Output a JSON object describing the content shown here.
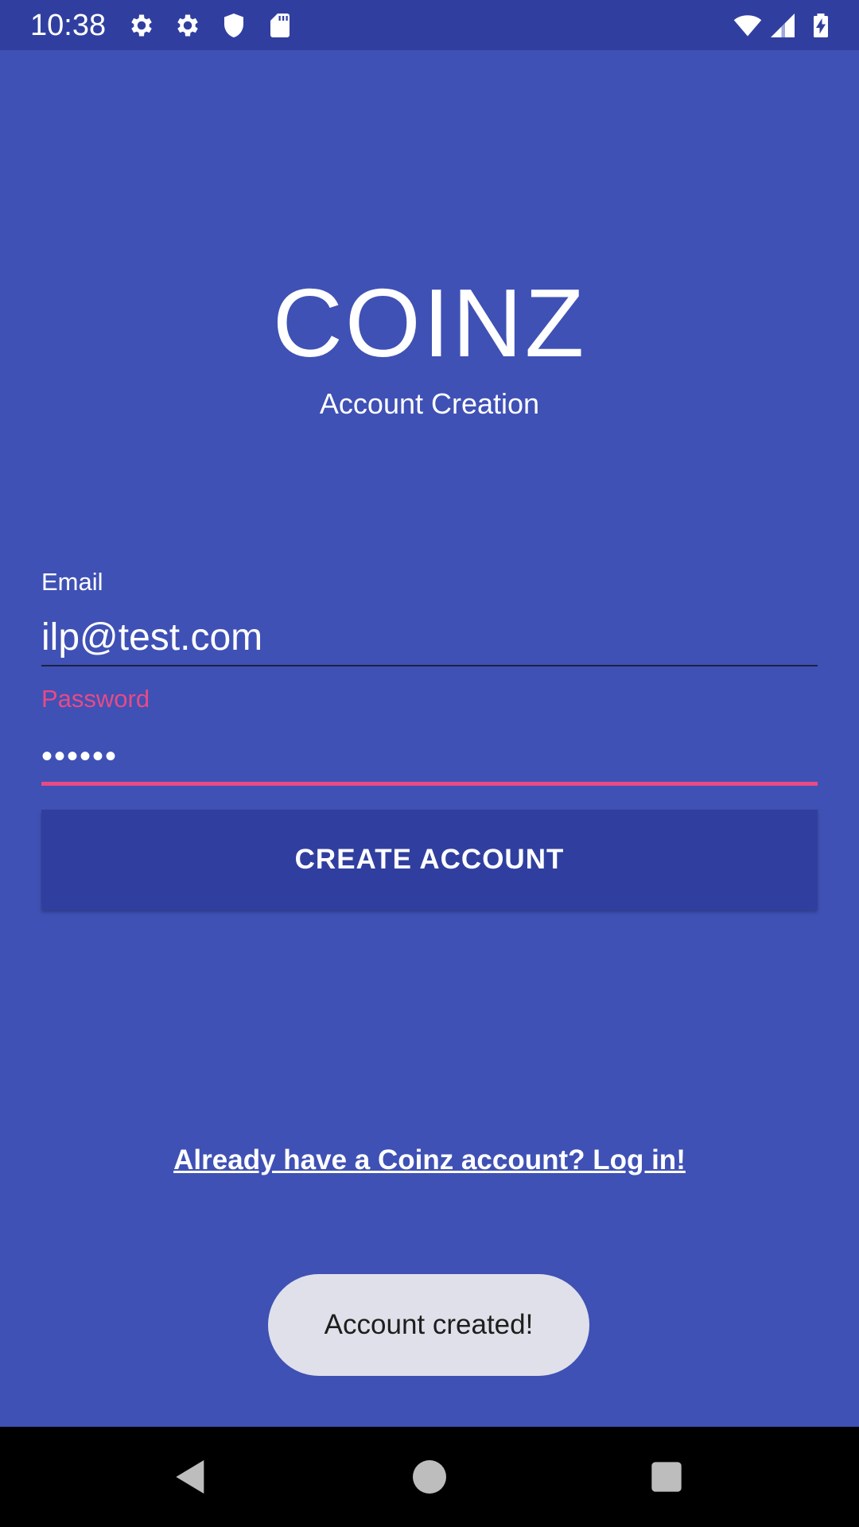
{
  "status_bar": {
    "time": "10:38",
    "icons_left": [
      "gear-icon",
      "gear-icon",
      "shield-icon",
      "sd-card-icon"
    ],
    "icons_right": [
      "wifi-icon",
      "signal-icon",
      "battery-charging-icon"
    ]
  },
  "header": {
    "title": "COINZ",
    "subtitle": "Account Creation"
  },
  "form": {
    "email": {
      "label": "Email",
      "value": "ilp@test.com"
    },
    "password": {
      "label": "Password",
      "value": "••••••"
    },
    "submit_label": "CREATE ACCOUNT"
  },
  "login_link": "Already have a Coinz account? Log in!",
  "toast": "Account created!",
  "nav_bar": {
    "buttons": [
      "back-icon",
      "home-icon",
      "recents-icon"
    ]
  },
  "colors": {
    "background": "#3f51b5",
    "primary_dark": "#303f9f",
    "accent": "#e84a86",
    "toast_bg": "#dfe0ea"
  }
}
